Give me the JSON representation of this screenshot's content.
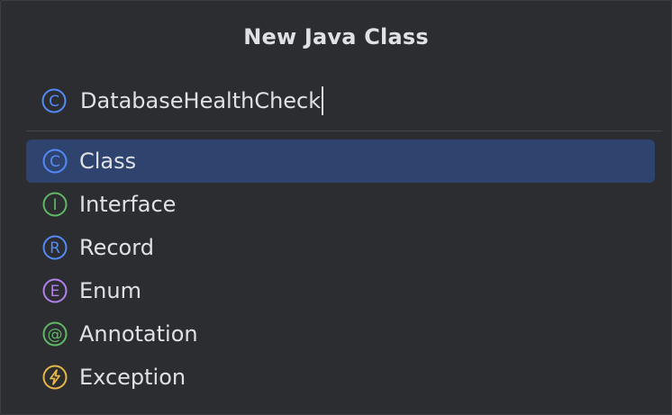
{
  "dialog": {
    "title": "New Java Class",
    "name_input": {
      "value": "DatabaseHealthCheck",
      "icon": "class-icon"
    }
  },
  "kinds": [
    {
      "label": "Class",
      "icon": "class-icon",
      "letter": "C",
      "color": "#548af7",
      "selected": true
    },
    {
      "label": "Interface",
      "icon": "interface-icon",
      "letter": "I",
      "color": "#5fb865",
      "selected": false
    },
    {
      "label": "Record",
      "icon": "record-icon",
      "letter": "R",
      "color": "#548af7",
      "selected": false
    },
    {
      "label": "Enum",
      "icon": "enum-icon",
      "letter": "E",
      "color": "#b281eb",
      "selected": false
    },
    {
      "label": "Annotation",
      "icon": "annotation-icon",
      "letter": "@",
      "color": "#5fb865",
      "selected": false
    },
    {
      "label": "Exception",
      "icon": "exception-icon",
      "letter": "⚡",
      "color": "#e5b746",
      "selected": false
    }
  ],
  "colors": {
    "background": "#2b2d30",
    "selection": "#2e436e",
    "text": "#dfe1e5"
  }
}
